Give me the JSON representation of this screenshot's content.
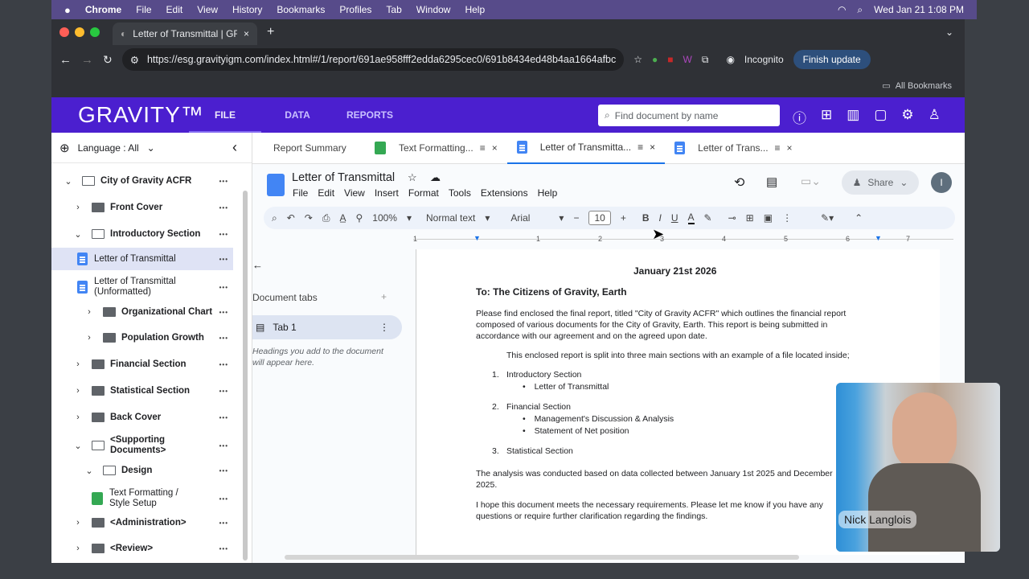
{
  "menubar": {
    "app": "Chrome",
    "items": [
      "File",
      "Edit",
      "View",
      "History",
      "Bookmarks",
      "Profiles",
      "Tab",
      "Window",
      "Help"
    ],
    "clock": "Wed Jan 21  1:08 PM"
  },
  "browser": {
    "tab_title": "Letter of Transmittal | GRAVIT",
    "url": "https://esg.gravityigm.com/index.html#/1/report/691ae958fff2edda6295cec0/691b8434ed48b4aa1664afbc",
    "incognito_label": "Incognito",
    "update_label": "Finish update",
    "all_bookmarks": "All Bookmarks"
  },
  "app": {
    "logo": "GRAVITY™",
    "nav": [
      "FILE",
      "DATA",
      "REPORTS"
    ],
    "search_placeholder": "Find document by name"
  },
  "sidebar": {
    "language": "Language : All",
    "tree": [
      {
        "label": "City of Gravity ACFR",
        "type": "folder-open",
        "chevron": "v"
      },
      {
        "label": "Front Cover",
        "type": "folder",
        "chevron": ">"
      },
      {
        "label": "Introductory Section",
        "type": "folder-open",
        "chevron": "v"
      },
      {
        "label": "Letter of Transmittal",
        "type": "doc",
        "chevron": ""
      },
      {
        "label": "Letter of Transmittal (Unformatted)",
        "type": "doc",
        "chevron": ""
      },
      {
        "label": "Organizational Chart",
        "type": "folder",
        "chevron": ">"
      },
      {
        "label": "Population Growth",
        "type": "folder",
        "chevron": ">"
      },
      {
        "label": "Financial Section",
        "type": "folder",
        "chevron": ">"
      },
      {
        "label": "Statistical Section",
        "type": "folder",
        "chevron": ">"
      },
      {
        "label": "Back Cover",
        "type": "folder",
        "chevron": ">"
      },
      {
        "label": "<Supporting Documents>",
        "type": "folder-open",
        "chevron": "v"
      },
      {
        "label": "Design",
        "type": "folder-open",
        "chevron": "v"
      },
      {
        "label": "Text Formatting / Style Setup",
        "type": "sheet",
        "chevron": ""
      },
      {
        "label": "<Administration>",
        "type": "folder",
        "chevron": ">"
      },
      {
        "label": "<Review>",
        "type": "folder",
        "chevron": ">"
      }
    ]
  },
  "doc_tabs": [
    "Report Summary",
    "Text Formatting...",
    "Letter of Transmitta...",
    "Letter of Trans..."
  ],
  "gdoc": {
    "title": "Letter of Transmittal",
    "menu": [
      "File",
      "Edit",
      "View",
      "Insert",
      "Format",
      "Tools",
      "Extensions",
      "Help"
    ],
    "share": "Share",
    "avatar": "I",
    "zoom": "100%",
    "style": "Normal text",
    "font": "Arial",
    "font_size": "10",
    "ruler_marks": [
      "1",
      "1",
      "2",
      "3",
      "4",
      "5",
      "6",
      "7"
    ],
    "outline": {
      "heading": "Document tabs",
      "tab": "Tab 1",
      "hint": "Headings you add to the document will appear here."
    },
    "body": {
      "date": "January 21st 2026",
      "to": "To: The Citizens of Gravity, Earth",
      "p1": "Please find enclosed the final report, titled \"City of Gravity ACFR\" which outlines the financial report composed of various documents for the City of Gravity, Earth. This report is being submitted in accordance with our agreement and on the agreed upon date.",
      "p2": "This enclosed report is split into three main sections with an example of a file located inside;",
      "list": [
        {
          "n": "1.",
          "label": "Introductory Section",
          "subs": [
            "Letter of Transmittal"
          ]
        },
        {
          "n": "2.",
          "label": "Financial Section",
          "subs": [
            "Management's Discussion & Analysis",
            "Statement of Net position"
          ]
        },
        {
          "n": "3.",
          "label": "Statistical Section",
          "subs": []
        }
      ],
      "p3": "The analysis was conducted based on data collected between January 1st 2025 and December 2025.",
      "p4": "I hope this document meets the necessary requirements. Please let me know if you have any questions or require further clarification regarding the findings."
    }
  },
  "video": {
    "name": "Nick Langlois"
  }
}
